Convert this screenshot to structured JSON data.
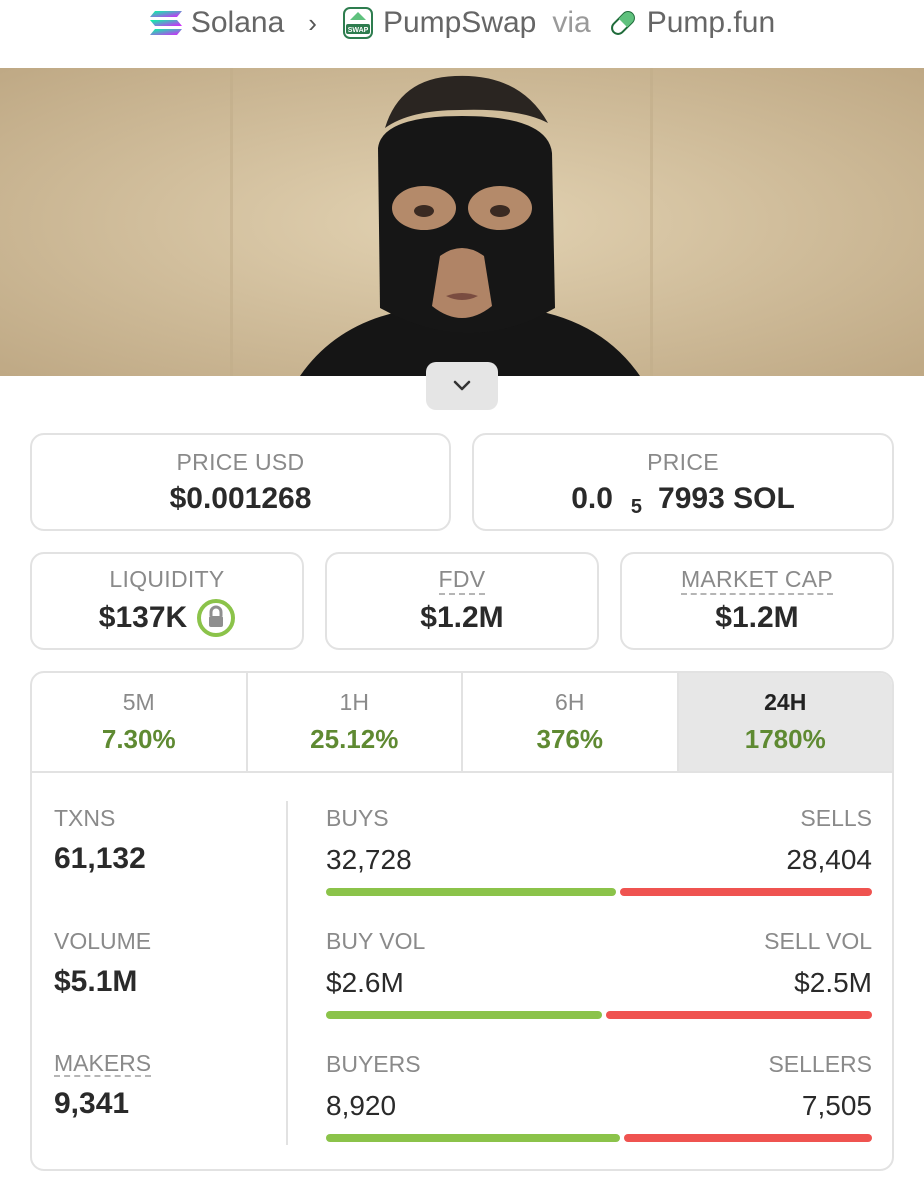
{
  "breadcrumb": {
    "chain": "Solana",
    "separator": "›",
    "dex": "PumpSwap",
    "dex_badge": "SWAP",
    "via": "via",
    "launchpad": "Pump.fun"
  },
  "banner": {
    "image": "token-banner-image"
  },
  "prices": {
    "usd_label": "PRICE USD",
    "usd_value": "$0.001268",
    "native_label": "PRICE",
    "native_prefix": "0.0",
    "native_zeros": "5",
    "native_suffix": "7993 SOL"
  },
  "metrics": {
    "liquidity_label": "LIQUIDITY",
    "liquidity_value": "$137K",
    "fdv_label": "FDV",
    "fdv_value": "$1.2M",
    "mcap_label": "MARKET CAP",
    "mcap_value": "$1.2M"
  },
  "timeframes": [
    {
      "label": "5M",
      "change": "7.30%",
      "active": false
    },
    {
      "label": "1H",
      "change": "25.12%",
      "active": false
    },
    {
      "label": "6H",
      "change": "376%",
      "active": false
    },
    {
      "label": "24H",
      "change": "1780%",
      "active": true
    }
  ],
  "stats": {
    "txns_label": "TXNS",
    "txns_value": "61,132",
    "volume_label": "VOLUME",
    "volume_value": "$5.1M",
    "makers_label": "MAKERS",
    "makers_value": "9,341",
    "buys_label": "BUYS",
    "buys_value": "32,728",
    "sells_label": "SELLS",
    "sells_value": "28,404",
    "buyvol_label": "BUY VOL",
    "buyvol_value": "$2.6M",
    "sellvol_label": "SELL VOL",
    "sellvol_value": "$2.5M",
    "buyers_label": "BUYERS",
    "buyers_value": "8,920",
    "sellers_label": "SELLERS",
    "sellers_value": "7,505",
    "buy_share_txns": 0.535,
    "buy_share_vol": 0.51,
    "buy_share_makers": 0.543
  },
  "colors": {
    "positive": "#5f8a32",
    "buy_bar": "#8bc34a",
    "sell_bar": "#ef5350",
    "lock_green": "#8bc34a"
  }
}
